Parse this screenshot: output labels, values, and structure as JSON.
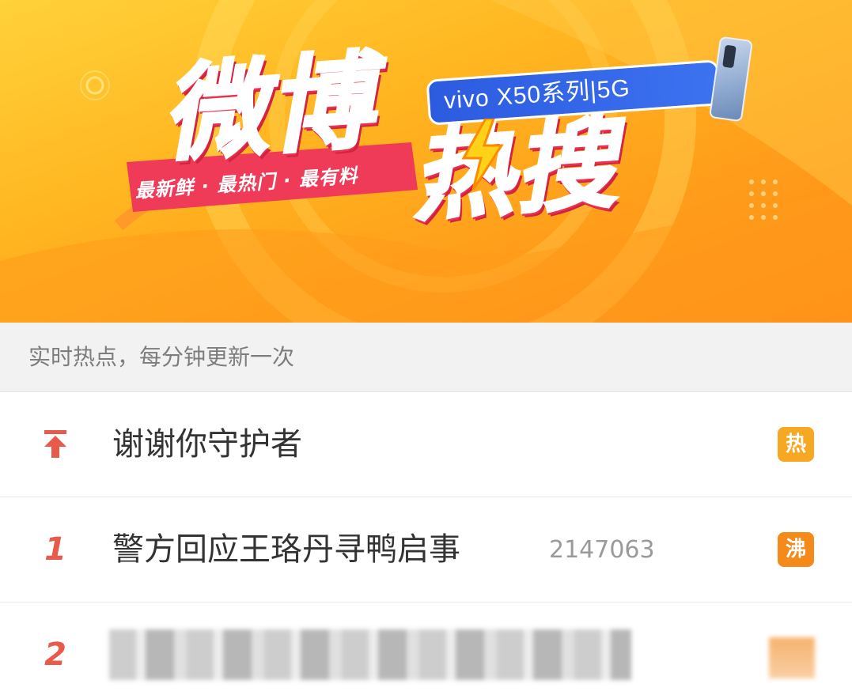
{
  "banner": {
    "title_part1": "微博",
    "title_part2": "热搜",
    "slogan": "最新鲜 · 最热门 · 最有料",
    "sponsor": "vivo X50系列|5G"
  },
  "subheader": {
    "text": "实时热点，每分钟更新一次"
  },
  "list": {
    "items": [
      {
        "rank": "",
        "pinned": true,
        "title": "谢谢你守护者",
        "count": "",
        "badge": "热",
        "badge_color": "#f7a823"
      },
      {
        "rank": "1",
        "pinned": false,
        "title": "警方回应王珞丹寻鸭启事",
        "count": "2147063",
        "badge": "沸",
        "badge_color": "#f48a1a"
      },
      {
        "rank": "2",
        "pinned": false,
        "title": "",
        "count": "",
        "badge": "",
        "badge_color": "#f5a04a"
      }
    ]
  },
  "colors": {
    "accent_red": "#e85a4a",
    "banner_orange": "#ffb520"
  }
}
